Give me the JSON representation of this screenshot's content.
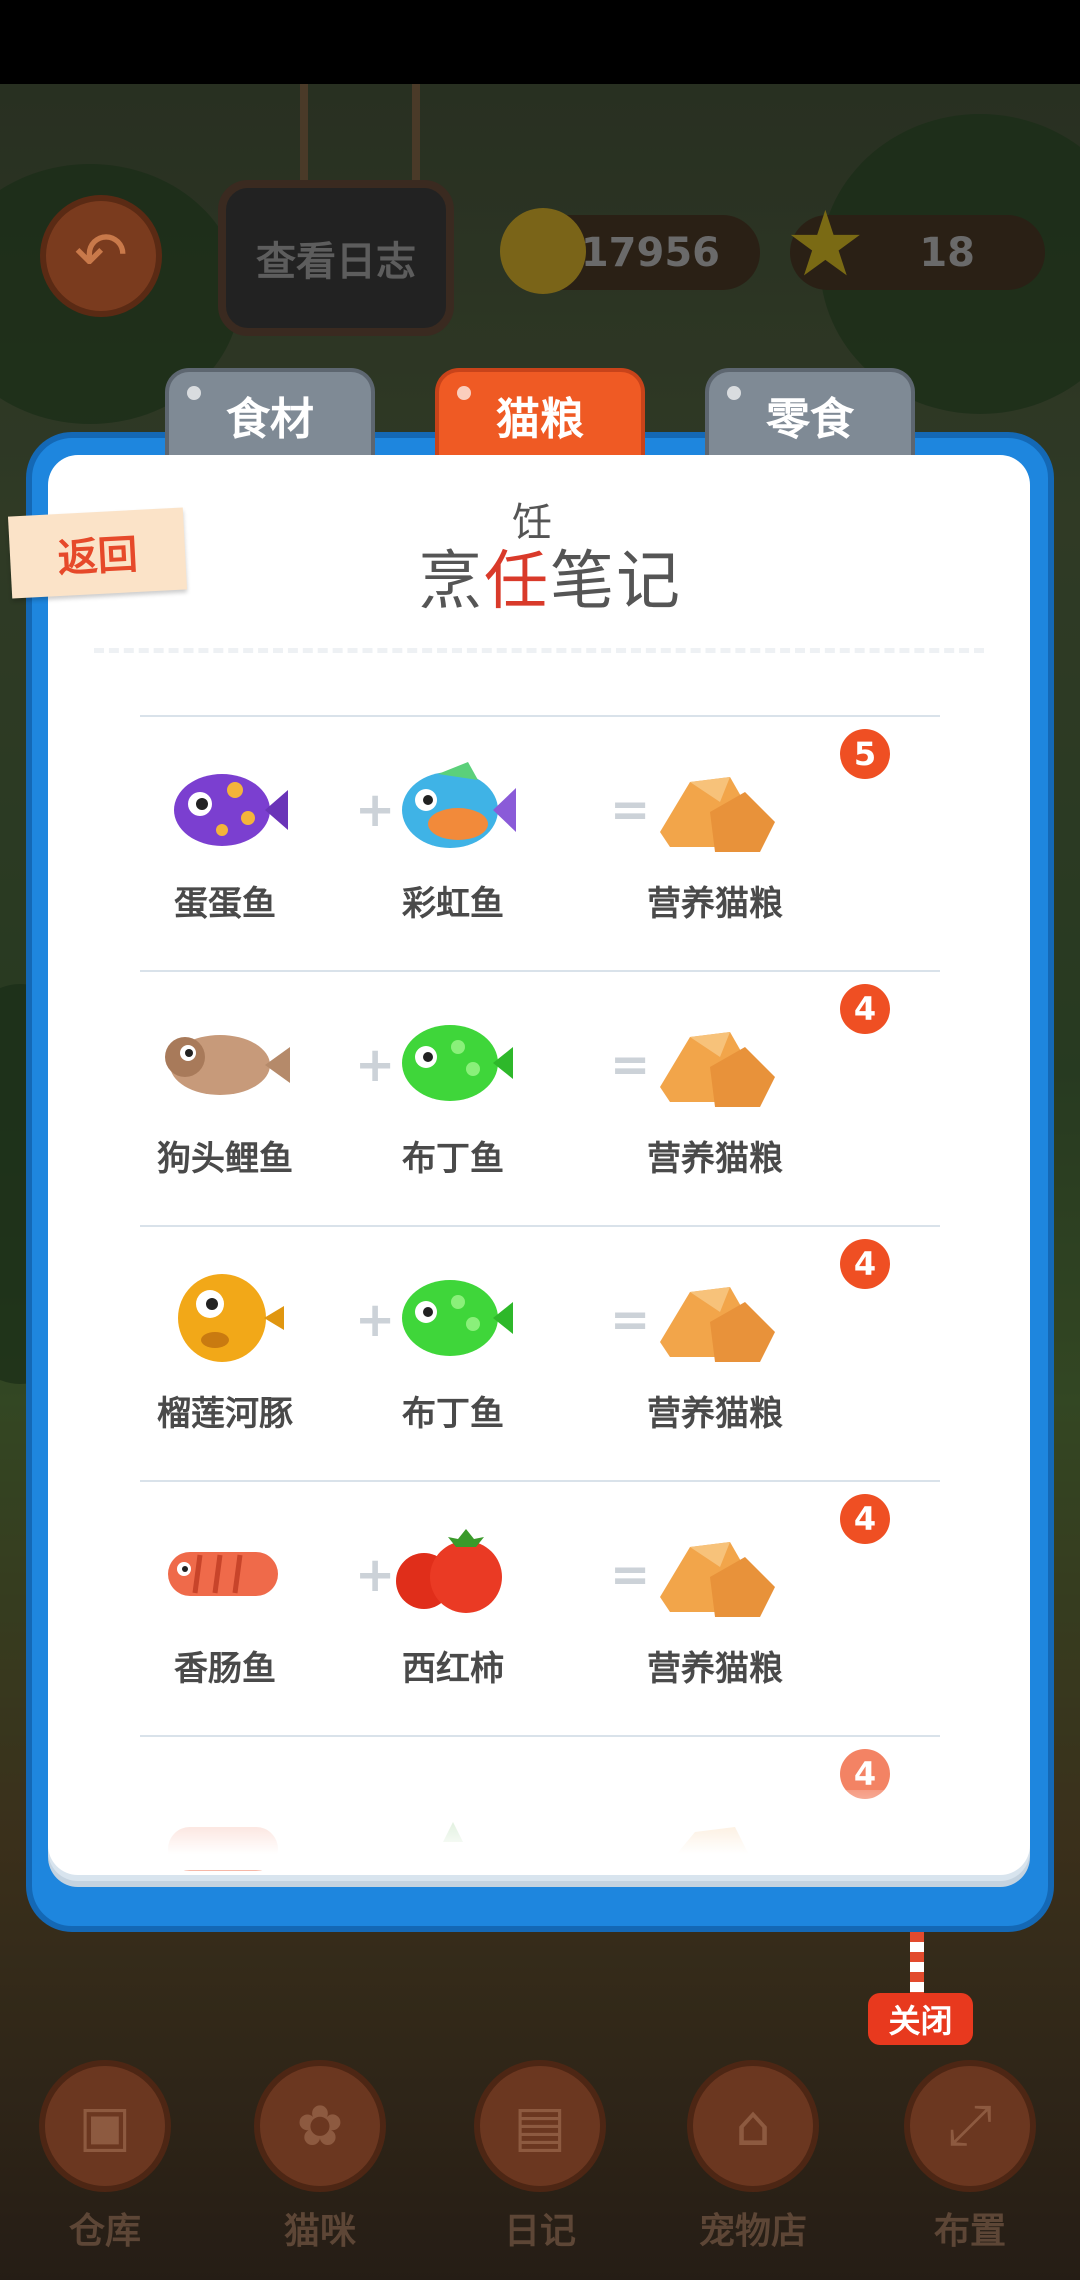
{
  "hud": {
    "log_label": "查看日志",
    "coins": "17956",
    "stars": "18"
  },
  "tabs": [
    {
      "label": "食材"
    },
    {
      "label": "猫粮"
    },
    {
      "label": "零食"
    }
  ],
  "panel": {
    "back_label": "返回",
    "title_part1": "烹",
    "title_wrong": "任",
    "title_part2": "笔记",
    "title_fix": "饪"
  },
  "recipes": [
    {
      "a": "蛋蛋鱼",
      "b": "彩虹鱼",
      "result": "营养猫粮",
      "count": "5"
    },
    {
      "a": "狗头鲤鱼",
      "b": "布丁鱼",
      "result": "营养猫粮",
      "count": "4"
    },
    {
      "a": "榴莲河豚",
      "b": "布丁鱼",
      "result": "营养猫粮",
      "count": "4"
    },
    {
      "a": "香肠鱼",
      "b": "西红柿",
      "result": "营养猫粮",
      "count": "4"
    },
    {
      "a": "",
      "b": "",
      "result": "",
      "count": "4"
    }
  ],
  "ops": {
    "plus": "+",
    "equals": "="
  },
  "close_label": "关闭",
  "nav": [
    {
      "label": "仓库",
      "icon": "box-icon"
    },
    {
      "label": "猫咪",
      "icon": "paw-icon"
    },
    {
      "label": "日记",
      "icon": "notebook-icon"
    },
    {
      "label": "宠物店",
      "icon": "shop-icon"
    },
    {
      "label": "布置",
      "icon": "expand-icon"
    }
  ]
}
